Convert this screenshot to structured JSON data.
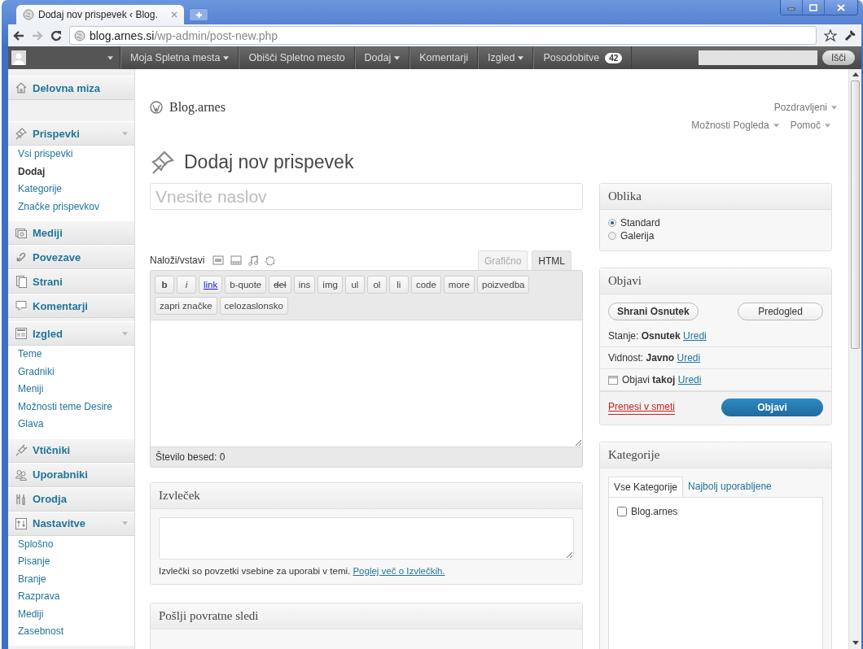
{
  "browser": {
    "tab_title": "Dodaj nov prispevek ‹ Blog.",
    "url_host": "blog.arnes.si",
    "url_path": "/wp-admin/post-new.php"
  },
  "admin_bar": {
    "items": [
      {
        "label": "Moja Spletna mesta",
        "dropdown": true
      },
      {
        "label": "Obišči Spletno mesto",
        "dropdown": false
      },
      {
        "label": "Dodaj",
        "dropdown": true
      },
      {
        "label": "Komentarji",
        "dropdown": false
      },
      {
        "label": "Izgled",
        "dropdown": true
      },
      {
        "label": "Posodobitve",
        "dropdown": false,
        "badge": "42"
      }
    ],
    "search_button": "Išči"
  },
  "sidebar": {
    "items": [
      {
        "label": "Delovna miza",
        "expanded": false
      },
      {
        "label": "Prispevki",
        "expanded": true,
        "children": [
          {
            "label": "Vsi prispevki",
            "selected": false
          },
          {
            "label": "Dodaj",
            "selected": true
          },
          {
            "label": "Kategorije",
            "selected": false
          },
          {
            "label": "Značke prispevkov",
            "selected": false
          }
        ]
      },
      {
        "label": "Mediji",
        "expanded": false
      },
      {
        "label": "Povezave",
        "expanded": false
      },
      {
        "label": "Strani",
        "expanded": false
      },
      {
        "label": "Komentarji",
        "expanded": false
      },
      {
        "label": "Izgled",
        "expanded": true,
        "children": [
          {
            "label": "Teme",
            "selected": false
          },
          {
            "label": "Gradniki",
            "selected": false
          },
          {
            "label": "Meniji",
            "selected": false
          },
          {
            "label": "Možnosti teme Desire",
            "selected": false
          },
          {
            "label": "Glava",
            "selected": false
          }
        ]
      },
      {
        "label": "Vtičniki",
        "expanded": false
      },
      {
        "label": "Uporabniki",
        "expanded": false
      },
      {
        "label": "Orodja",
        "expanded": false
      },
      {
        "label": "Nastavitve",
        "expanded": true,
        "children": [
          {
            "label": "Splošno",
            "selected": false
          },
          {
            "label": "Pisanje",
            "selected": false
          },
          {
            "label": "Branje",
            "selected": false
          },
          {
            "label": "Razprava",
            "selected": false
          },
          {
            "label": "Mediji",
            "selected": false
          },
          {
            "label": "Zasebnost",
            "selected": false
          }
        ]
      }
    ]
  },
  "site_name": "Blog.arnes",
  "greeting": "Pozdravljeni",
  "screen_links": [
    "Možnosti Pogleda",
    "Pomoč"
  ],
  "page_title": "Dodaj nov prispevek",
  "title_field": {
    "placeholder": "Vnesite naslov"
  },
  "editor": {
    "upload_label": "Naloži/vstavi",
    "tabs": [
      {
        "label": "Grafično",
        "selected": false
      },
      {
        "label": "HTML",
        "selected": true
      }
    ],
    "buttons": [
      {
        "label": "b",
        "kind": "bold"
      },
      {
        "label": "i",
        "kind": "italic"
      },
      {
        "label": "link",
        "kind": "link"
      },
      {
        "label": "b-quote",
        "kind": "plain"
      },
      {
        "label": "del",
        "kind": "strike"
      },
      {
        "label": "ins",
        "kind": "plain"
      },
      {
        "label": "img",
        "kind": "plain"
      },
      {
        "label": "ul",
        "kind": "plain"
      },
      {
        "label": "ol",
        "kind": "plain"
      },
      {
        "label": "li",
        "kind": "plain"
      },
      {
        "label": "code",
        "kind": "plain"
      },
      {
        "label": "more",
        "kind": "plain"
      },
      {
        "label": "poizvedba",
        "kind": "plain"
      },
      {
        "label": "zapri značke",
        "kind": "plain"
      },
      {
        "label": "celozaslonsko",
        "kind": "plain"
      }
    ],
    "word_count": "Število besed: 0"
  },
  "excerpt": {
    "title": "Izvleček",
    "help": "Izvlečki so povzetki vsebine za uporabi v temi.",
    "link": "Poglej več o Izvlečkih."
  },
  "trackbacks": {
    "title": "Pošlji povratne sledi"
  },
  "format_box": {
    "title": "Oblika",
    "options": [
      {
        "label": "Standard",
        "selected": true
      },
      {
        "label": "Galerija",
        "selected": false
      }
    ]
  },
  "publish_box": {
    "title": "Objavi",
    "save_button": "Shrani Osnutek",
    "preview_button": "Predogled",
    "rows": [
      {
        "kind": "status",
        "text": "Stanje: **Osnutek**",
        "link": "Uredi"
      },
      {
        "kind": "visibility",
        "text": "Vidnost: **Javno**",
        "link": "Uredi"
      },
      {
        "kind": "schedule",
        "text": "Objavi **takoj**",
        "link": "Uredi"
      }
    ],
    "trash_link": "Prenesi v smeti",
    "publish_button": "Objavi"
  },
  "categories_box": {
    "title": "Kategorije",
    "tabs": [
      {
        "label": "Vse Kategorije",
        "selected": true
      },
      {
        "label": "Najbolj uporabljene",
        "selected": false
      }
    ],
    "items": [
      {
        "label": "Blog.arnes",
        "checked": false
      }
    ]
  }
}
